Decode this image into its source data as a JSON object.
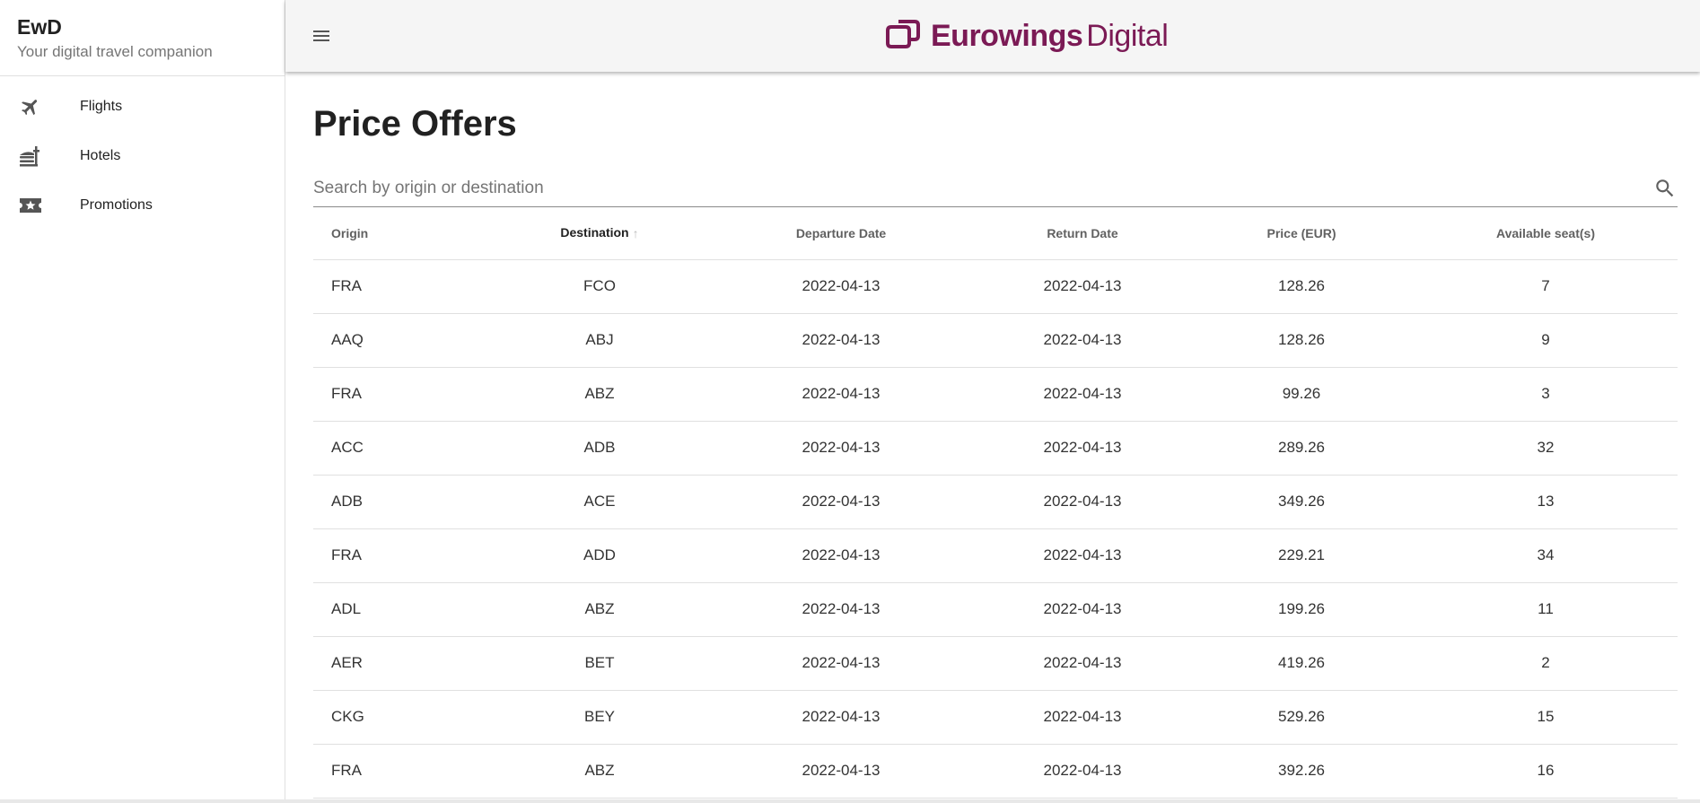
{
  "sidebar": {
    "app_name": "EwD",
    "tagline": "Your digital travel companion",
    "items": [
      {
        "label": "Flights",
        "icon": "airplane-icon"
      },
      {
        "label": "Hotels",
        "icon": "hotel-icon"
      },
      {
        "label": "Promotions",
        "icon": "ticket-star-icon"
      }
    ]
  },
  "topbar": {
    "menu_icon": "hamburger-menu-icon",
    "logo": {
      "brand_bold": "Eurowings",
      "brand_light": "Digital"
    }
  },
  "main": {
    "title": "Price Offers",
    "search": {
      "placeholder": "Search by origin or destination",
      "value": ""
    },
    "table": {
      "columns": [
        "Origin",
        "Destination",
        "Departure Date",
        "Return Date",
        "Price (EUR)",
        "Available seat(s)"
      ],
      "sorted_column": "Destination",
      "sort_direction": "ascending",
      "rows": [
        [
          "FRA",
          "FCO",
          "2022-04-13",
          "2022-04-13",
          "128.26",
          "7"
        ],
        [
          "AAQ",
          "ABJ",
          "2022-04-13",
          "2022-04-13",
          "128.26",
          "9"
        ],
        [
          "FRA",
          "ABZ",
          "2022-04-13",
          "2022-04-13",
          "99.26",
          "3"
        ],
        [
          "ACC",
          "ADB",
          "2022-04-13",
          "2022-04-13",
          "289.26",
          "32"
        ],
        [
          "ADB",
          "ACE",
          "2022-04-13",
          "2022-04-13",
          "349.26",
          "13"
        ],
        [
          "FRA",
          "ADD",
          "2022-04-13",
          "2022-04-13",
          "229.21",
          "34"
        ],
        [
          "ADL",
          "ABZ",
          "2022-04-13",
          "2022-04-13",
          "199.26",
          "11"
        ],
        [
          "AER",
          "BET",
          "2022-04-13",
          "2022-04-13",
          "419.26",
          "2"
        ],
        [
          "CKG",
          "BEY",
          "2022-04-13",
          "2022-04-13",
          "529.26",
          "15"
        ],
        [
          "FRA",
          "ABZ",
          "2022-04-13",
          "2022-04-13",
          "392.26",
          "16"
        ]
      ]
    }
  },
  "colors": {
    "brand": "#7b1a55",
    "topbar_bg": "#f5f5f5",
    "divider": "#e0e0e0"
  }
}
